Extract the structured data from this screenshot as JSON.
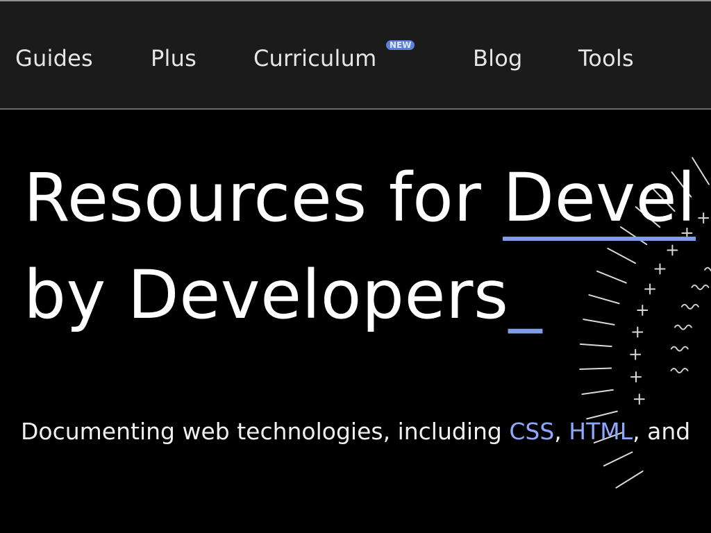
{
  "nav": {
    "items": [
      {
        "label": "Guides"
      },
      {
        "label": "Plus"
      },
      {
        "label": "Curriculum",
        "badge": "NEW"
      },
      {
        "label": "Blog"
      },
      {
        "label": "Tools"
      }
    ]
  },
  "hero": {
    "title_line1_prefix": "Resources for ",
    "title_line1_highlight": "Devel",
    "title_line2": "by Developers",
    "title_cursor": "_",
    "subtitle_prefix": "Documenting web technologies, including ",
    "subtitle_link_css": "CSS",
    "subtitle_sep1": ", ",
    "subtitle_link_html": "HTML",
    "subtitle_sep2": ", ",
    "subtitle_suffix": "and"
  },
  "colors": {
    "background": "#000000",
    "nav_background": "#1b1b1b",
    "accent": "#7f9eea",
    "badge_background": "#5e7fd8",
    "link": "#8ea8ff"
  }
}
